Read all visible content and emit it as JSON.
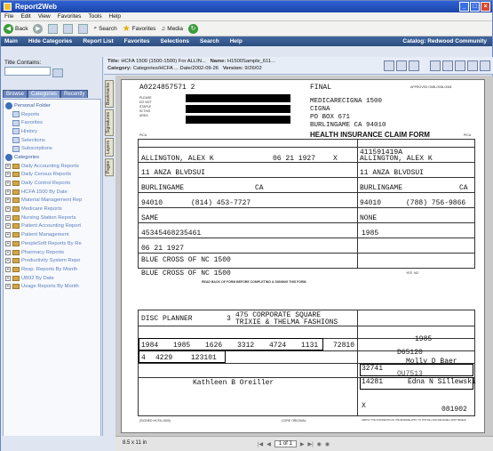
{
  "window": {
    "title": "Report2Web"
  },
  "menubar": [
    "File",
    "Edit",
    "View",
    "Favorites",
    "Tools",
    "Help"
  ],
  "toolbar": {
    "back": "Back",
    "search": "Search",
    "favorites": "Favorites",
    "media": "Media"
  },
  "appnav": {
    "items": [
      "Main",
      "Hide Categories",
      "Report List",
      "Favorites",
      "Selections",
      "Search",
      "Help"
    ],
    "right": "Catalog: Redwood Community"
  },
  "left": {
    "title_contains_label": "Title Contains:",
    "tabs": [
      "Browse",
      "Categories",
      "Recently"
    ],
    "tree": [
      {
        "label": "Personal Folder",
        "kind": "top"
      },
      {
        "label": "Reports",
        "kind": "item"
      },
      {
        "label": "Favorites",
        "kind": "item"
      },
      {
        "label": "History",
        "kind": "item"
      },
      {
        "label": "Selections",
        "kind": "item"
      },
      {
        "label": "Subscriptions",
        "kind": "item"
      },
      {
        "label": "Categories",
        "kind": "top"
      },
      {
        "label": "Daily Accounting Reports",
        "kind": "folder"
      },
      {
        "label": "Daily Census Reports",
        "kind": "folder"
      },
      {
        "label": "Daily Control Reports",
        "kind": "folder"
      },
      {
        "label": "HCFA 1500 By Date",
        "kind": "folder"
      },
      {
        "label": "Material Management Rep",
        "kind": "folder"
      },
      {
        "label": "Medicare Reports",
        "kind": "folder"
      },
      {
        "label": "Nursing Station Reports",
        "kind": "folder"
      },
      {
        "label": "Patient Accounting Report",
        "kind": "folder"
      },
      {
        "label": "Patient Management",
        "kind": "folder"
      },
      {
        "label": "PeopleSoft Reports By Re",
        "kind": "folder"
      },
      {
        "label": "Pharmacy Reports",
        "kind": "folder"
      },
      {
        "label": "Productivity System Repo",
        "kind": "folder"
      },
      {
        "label": "Resp. Reports By Month",
        "kind": "folder"
      },
      {
        "label": "UB92 By Date",
        "kind": "folder"
      },
      {
        "label": "Usage Reports By Month",
        "kind": "folder"
      }
    ]
  },
  "content_header": {
    "title_label": "Title:",
    "title_value": "HCFA 1500 (1500-1500) For ALLIN...",
    "name_label": "Name:",
    "name_value": "H1500Sample_611...",
    "category_label": "Category:",
    "category_value": "Categories/HCFA ... Date/2002-09-26",
    "version_label": "Version:",
    "version_value": "9/26/02"
  },
  "side_tabs": [
    "Bookmarks",
    "Signatures",
    "Layers",
    "Pages"
  ],
  "form": {
    "control_no": "A0224857571  2",
    "final": "FINAL",
    "please_lines": [
      "PLEASE",
      "DO NOT",
      "STAPLE",
      "IN THIS",
      "AREA"
    ],
    "approved": "APPROVED OMB-0938-0008",
    "insurer_lines": [
      "MEDICARECIGNA 1500",
      "CIGNA",
      "PO BOX 671",
      "BURLINGAME          CA  94010"
    ],
    "heading": "HEALTH INSURANCE CLAIM FORM",
    "pica": "PICA",
    "insured_id": "411591419A",
    "patient_name": "ALLINGTON, ALEX K",
    "birth_date": "06 21 1927",
    "sex_mark": "X",
    "insured_name": "ALLINGTON, ALEX K",
    "patient_address": "11 ANZA BLVDSUI",
    "insured_address": "11 ANZA BLVDSUI",
    "city": "BURLINGAME",
    "state": "CA",
    "insured_city": "BURLINGAME",
    "insured_state": "CA",
    "zip": "94010",
    "phone": "(814)  453-7727",
    "insured_zip": "94010",
    "insured_phone": "(788)  756-9866",
    "same": "SAME",
    "other_id": "45345468235461",
    "none": "NONE",
    "dob2": "06 21 1927",
    "plan1": "BLUE CROSS OF NC 1500",
    "plan2": "BLUE CROSS OF NC 1500",
    "auth_text": "READ BACK OF FORM BEFORE COMPLETING & SIGNING THIS FORM.",
    "employer_label": "DISC PLANNER",
    "employer_addr": "475 CORPORATE SQUARE",
    "employer_name": "TRIXIE & THELMA FASHIONS",
    "employer_num": "3",
    "year1": "1985",
    "year2": "1985",
    "dates_row": [
      "1984",
      "1985",
      "1626",
      "3312",
      "4724",
      "1131",
      "72810"
    ],
    "code_row": [
      "4",
      "4229",
      "123101"
    ],
    "ref_no": "D65120",
    "provider1": "Molly D Baer",
    "pin1": "32741",
    "grp_no": "OU7513",
    "pin2": "14281",
    "provider2": "Edna N Sillewski",
    "signature": "Kathleen B Oreiller",
    "sig_no": "081902",
    "x_mark": "X",
    "footer_left": "(SIGNED HCFA-1500)",
    "footer_mid": "CORE ORIGINAL",
    "footer_right": "CERTIFY THE STATEMENTS ON THE REVERSE APPLY TO THIS BILL AND ARE MADE A PART HEREOF"
  },
  "statusbar": {
    "zoom": "8.5 x 11 in",
    "page": "1 of 1"
  }
}
